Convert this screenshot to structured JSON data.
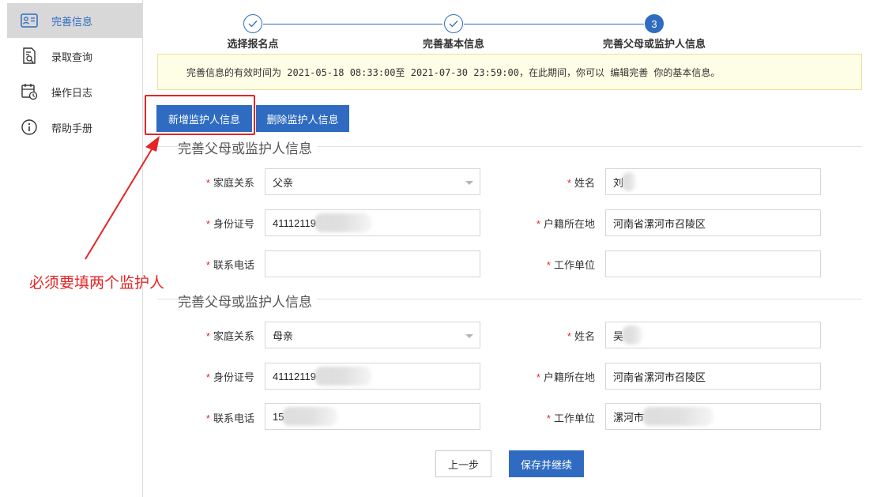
{
  "sidebar": {
    "items": [
      {
        "label": "完善信息",
        "icon": "id-card-icon",
        "active": true
      },
      {
        "label": "录取查询",
        "icon": "document-search-icon",
        "active": false
      },
      {
        "label": "操作日志",
        "icon": "calendar-clock-icon",
        "active": false
      },
      {
        "label": "帮助手册",
        "icon": "info-icon",
        "active": false
      }
    ]
  },
  "steps": [
    {
      "label": "选择报名点",
      "status": "done",
      "icon": "check-icon"
    },
    {
      "label": "完善基本信息",
      "status": "done",
      "icon": "check-icon"
    },
    {
      "label": "完善父母或监护人信息",
      "status": "current",
      "number": "3"
    }
  ],
  "notice": {
    "text": "完善信息的有效时间为 2021-05-18 08:33:00至 2021-07-30 23:59:00，在此期间，你可以 编辑完善 你的基本信息。"
  },
  "actions": {
    "add_guardian": "新增监护人信息",
    "delete_guardian": "删除监护人信息"
  },
  "guardians": [
    {
      "section_title": "完善父母或监护人信息",
      "relation_label": "家庭关系",
      "relation_value": "父亲",
      "name_label": "姓名",
      "name_value": "刘",
      "id_label": "身份证号",
      "id_value": "41112119",
      "hukou_label": "户籍所在地",
      "hukou_value": "河南省漯河市召陵区",
      "phone_label": "联系电话",
      "phone_value": "",
      "work_label": "工作单位",
      "work_value": ""
    },
    {
      "section_title": "完善父母或监护人信息",
      "relation_label": "家庭关系",
      "relation_value": "母亲",
      "name_label": "姓名",
      "name_value": "吴",
      "id_label": "身份证号",
      "id_value": "41112119",
      "hukou_label": "户籍所在地",
      "hukou_value": "河南省漯河市召陵区",
      "phone_label": "联系电话",
      "phone_value": "15",
      "work_label": "工作单位",
      "work_value": "漯河市"
    }
  ],
  "footer": {
    "prev": "上一步",
    "save": "保存并继续"
  },
  "annotation": {
    "text": "必须要填两个监护人"
  },
  "colors": {
    "primary": "#2f6cc1",
    "annotation": "#e52525",
    "notice_bg": "#fefde5"
  }
}
